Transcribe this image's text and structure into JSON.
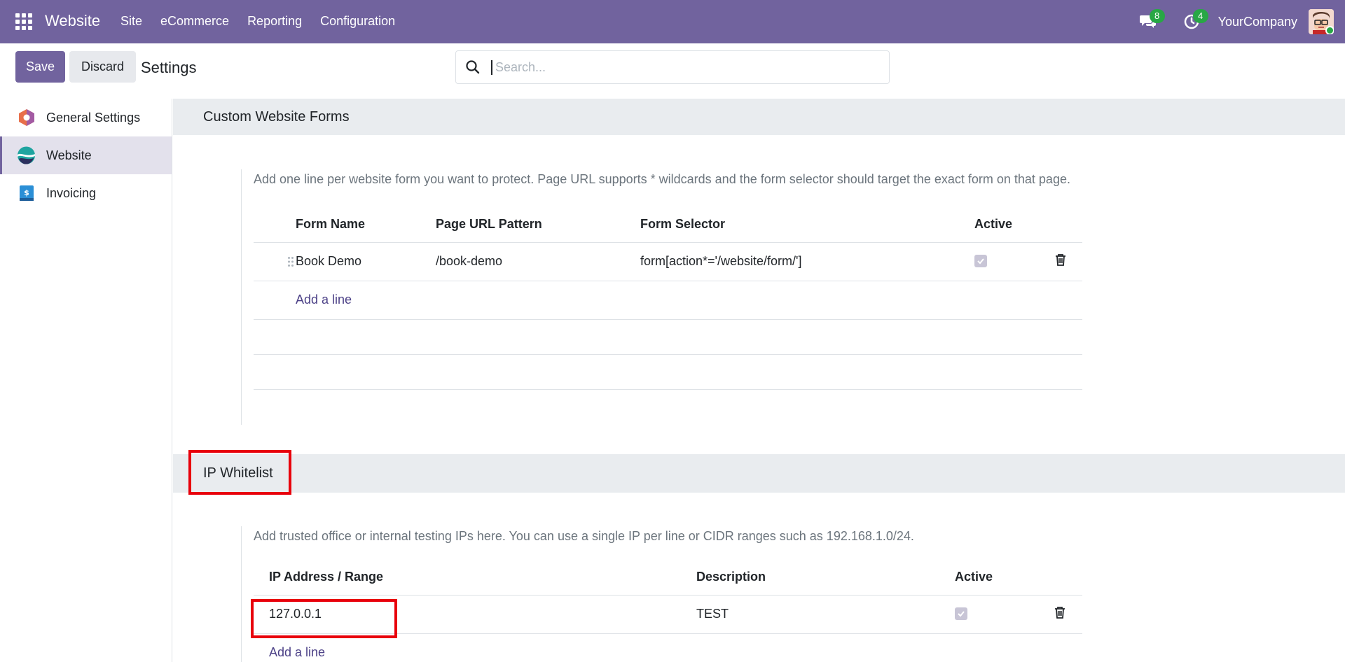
{
  "navbar": {
    "brand": "Website",
    "menu": [
      "Site",
      "eCommerce",
      "Reporting",
      "Configuration"
    ],
    "messages_count": "8",
    "activities_count": "4",
    "company": "YourCompany"
  },
  "control_panel": {
    "save_label": "Save",
    "discard_label": "Discard",
    "title": "Settings",
    "search_placeholder": "Search..."
  },
  "sidebar": {
    "items": [
      {
        "label": "General Settings"
      },
      {
        "label": "Website"
      },
      {
        "label": "Invoicing"
      }
    ]
  },
  "forms_section": {
    "title": "Custom Website Forms",
    "help": "Add one line per website form you want to protect. Page URL supports * wildcards and the form selector should target the exact form on that page.",
    "columns": [
      "Form Name",
      "Page URL Pattern",
      "Form Selector",
      "Active"
    ],
    "rows": [
      {
        "name": "Book Demo",
        "url": "/book-demo",
        "selector": "form[action*='/website/form/']",
        "active": true
      }
    ],
    "add_line": "Add a line"
  },
  "ip_section": {
    "title": "IP Whitelist",
    "help": "Add trusted office or internal testing IPs here. You can use a single IP per line or CIDR ranges such as 192.168.1.0/24.",
    "columns": [
      "IP Address / Range",
      "Description",
      "Active"
    ],
    "rows": [
      {
        "ip": "127.0.0.1",
        "description": "TEST",
        "active": true
      }
    ],
    "add_line": "Add a line"
  },
  "colors": {
    "brand": "#71639e",
    "highlight": "#e8000b",
    "badge": "#28a745"
  }
}
